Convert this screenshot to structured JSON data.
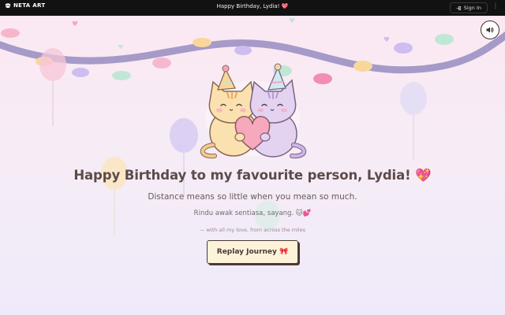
{
  "topbar": {
    "brand": "NETA ART",
    "title": "Happy Birthday, Lydia! 💖",
    "signin_label": "Sign In",
    "signin_icon": "sign-in-icon",
    "more_icon": "more-vertical-icon"
  },
  "hero": {
    "heading": "Happy Birthday to my favourite person, Lydia! 💖",
    "subheading": "Distance means so little when you mean so much.",
    "malay_line": "Rindu awak sentiasa, sayang. 🐱💕",
    "signature": "— with all my love, from across the miles",
    "replay_label": "Replay Journey 🎀"
  },
  "controls": {
    "sound_icon": "speaker-icon"
  },
  "colors": {
    "topbar_bg": "#121212",
    "garland": "#a59ac8",
    "heading": "#5c4b48",
    "button_bg": "#fdf3d9",
    "button_border": "#4a3a36",
    "heart": "#f7a8bd"
  }
}
